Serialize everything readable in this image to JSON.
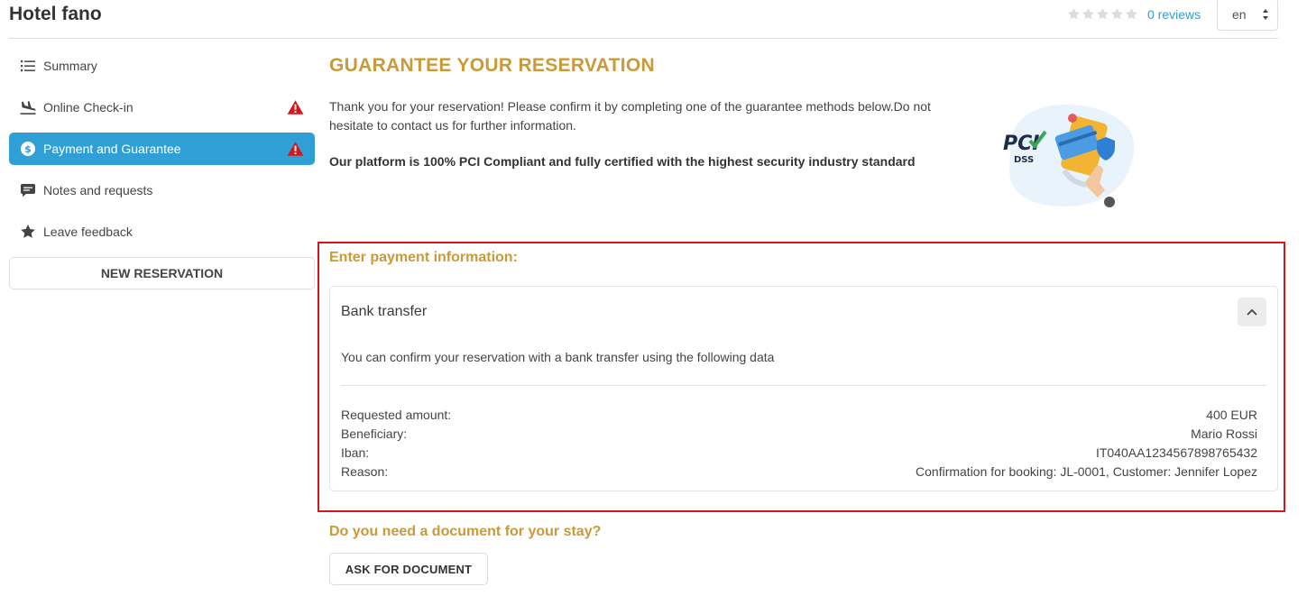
{
  "header": {
    "hotel_name": "Hotel fano",
    "rating": {
      "stars_filled": 0,
      "stars_total": 5
    },
    "reviews_label": "0 reviews",
    "language": "en"
  },
  "sidebar": {
    "items": [
      {
        "label": "Summary",
        "icon": "list-icon",
        "active": false,
        "warning": false
      },
      {
        "label": "Online Check-in",
        "icon": "plane-landing-icon",
        "active": false,
        "warning": true
      },
      {
        "label": "Payment and Guarantee",
        "icon": "dollar-circle-icon",
        "active": true,
        "warning": true
      },
      {
        "label": "Notes and requests",
        "icon": "comment-icon",
        "active": false,
        "warning": false
      },
      {
        "label": "Leave feedback",
        "icon": "star-icon",
        "active": false,
        "warning": false
      }
    ],
    "new_reservation_label": "NEW RESERVATION"
  },
  "main": {
    "title": "GUARANTEE YOUR RESERVATION",
    "intro": "Thank you for your reservation! Please confirm it by completing one of the guarantee methods below.Do not hesitate to contact us for further information.",
    "pci_statement": "Our platform is 100% PCI Compliant and fully certified with the highest security industry standard",
    "pci_badge_text": "PCI DSS COMPLIANT",
    "payment_section_title": "Enter payment information:",
    "bank_transfer": {
      "title": "Bank transfer",
      "description": "You can confirm your reservation with a bank transfer using the following data",
      "rows": [
        {
          "label": "Requested amount:",
          "value": "400 EUR"
        },
        {
          "label": "Beneficiary:",
          "value": "Mario Rossi"
        },
        {
          "label": "Iban:",
          "value": "IT040AA1234567898765432"
        },
        {
          "label": "Reason:",
          "value": "Confirmation for booking: JL-0001, Customer: Jennifer Lopez"
        }
      ]
    },
    "document_section_title": "Do you need a document for your stay?",
    "ask_document_label": "ASK FOR DOCUMENT"
  },
  "colors": {
    "accent_gold": "#c99a37",
    "active_blue": "#2f9fd6",
    "warning_red": "#d0191d",
    "highlight_border": "#d0191d"
  }
}
